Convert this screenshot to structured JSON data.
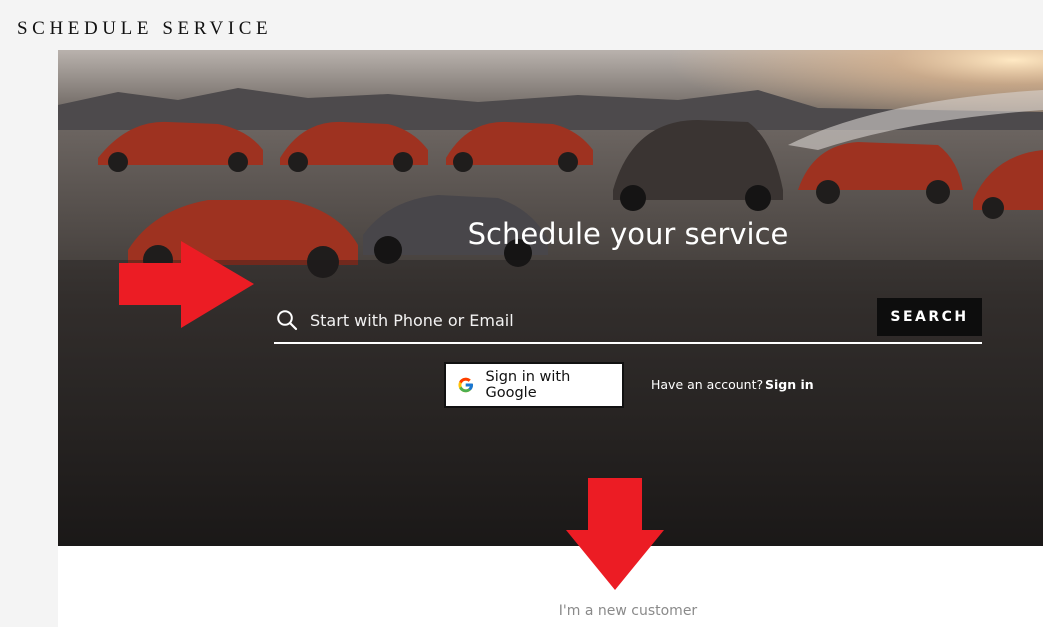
{
  "header": {
    "title": "SCHEDULE SERVICE"
  },
  "hero": {
    "title": "Schedule your service",
    "search": {
      "placeholder": "Start with Phone or Email",
      "value": "",
      "button_label": "SEARCH",
      "icon": "search-icon"
    },
    "google_signin": {
      "label": "Sign in with Google",
      "icon": "google-g-icon"
    },
    "account_prompt": "Have an account?",
    "signin_label": "Sign in"
  },
  "content": {
    "new_customer_label": "I'm a new customer"
  },
  "colors": {
    "annotation_arrow": "#ec1c24",
    "button_dark": "#0d0d0d",
    "muted_text": "#8a8a8a"
  }
}
